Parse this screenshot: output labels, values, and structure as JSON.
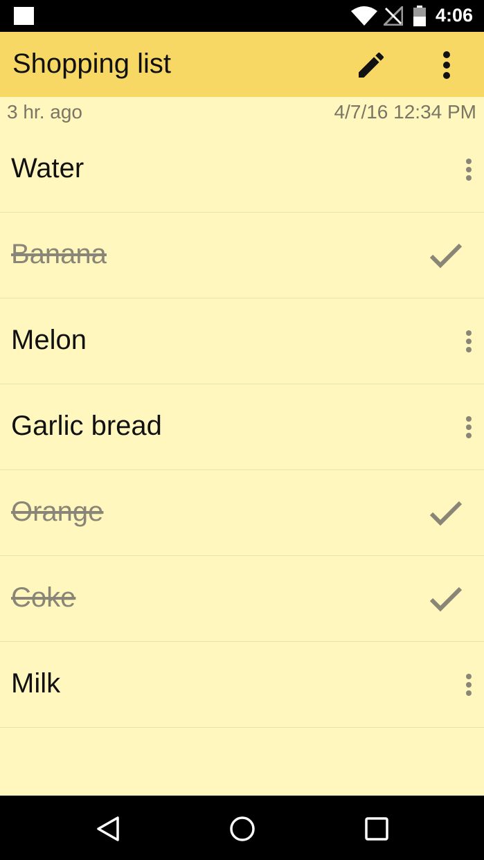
{
  "status_bar": {
    "time": "4:06",
    "icons": [
      "notification-square-icon",
      "wifi-icon",
      "signal-off-icon",
      "battery-icon"
    ]
  },
  "app_bar": {
    "title": "Shopping list",
    "actions": [
      "pencil-icon",
      "more-vert-icon"
    ]
  },
  "meta": {
    "relative_time": "3 hr. ago",
    "timestamp": "4/7/16 12:34 PM"
  },
  "items": [
    {
      "label": "Water",
      "done": false
    },
    {
      "label": "Banana",
      "done": true
    },
    {
      "label": "Melon",
      "done": false
    },
    {
      "label": "Garlic bread",
      "done": false
    },
    {
      "label": "Orange",
      "done": true
    },
    {
      "label": "Coke",
      "done": true
    },
    {
      "label": "Milk",
      "done": false
    }
  ],
  "colors": {
    "app_bar": "#f7d864",
    "background": "#fff7bd",
    "done_text": "#8a8677"
  },
  "nav_bar": {
    "icons": [
      "back-icon",
      "home-icon",
      "recents-icon"
    ]
  }
}
